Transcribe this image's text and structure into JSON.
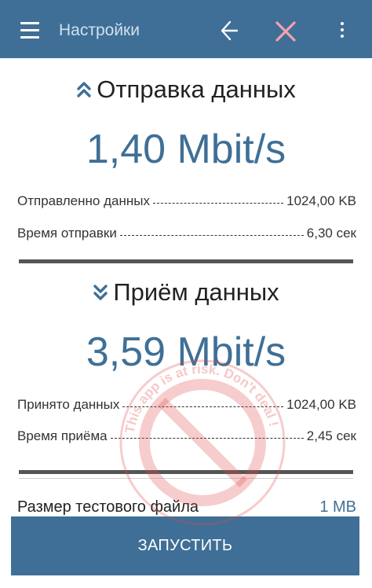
{
  "appbar": {
    "title": "Настройки"
  },
  "upload": {
    "heading": "Отправка данных",
    "speed": "1,40 Mbit/s",
    "rows": [
      {
        "label": "Отправленно данных",
        "value": "1024,00 KB"
      },
      {
        "label": "Время отправки",
        "value": "6,30 сек"
      }
    ]
  },
  "download": {
    "heading": "Приём данных",
    "speed": "3,59 Mbit/s",
    "rows": [
      {
        "label": "Принято данных",
        "value": "1024,00 KB"
      },
      {
        "label": "Время приёма",
        "value": "2,45 сек"
      }
    ]
  },
  "test_file": {
    "label": "Размер тестового файла",
    "value": "1 MB"
  },
  "run_label": "ЗАПУСТИТЬ",
  "watermark": {
    "text": "This app is at risk. Don't deal !",
    "color": "#e0484a"
  },
  "colors": {
    "accent": "#3f6f96",
    "title": "#cfe0ee",
    "close": "#f2a3ad"
  },
  "icons": [
    "menu-icon",
    "back-arrow-icon",
    "close-icon",
    "more-vert-icon",
    "chevron-up-double-icon",
    "chevron-down-double-icon"
  ]
}
